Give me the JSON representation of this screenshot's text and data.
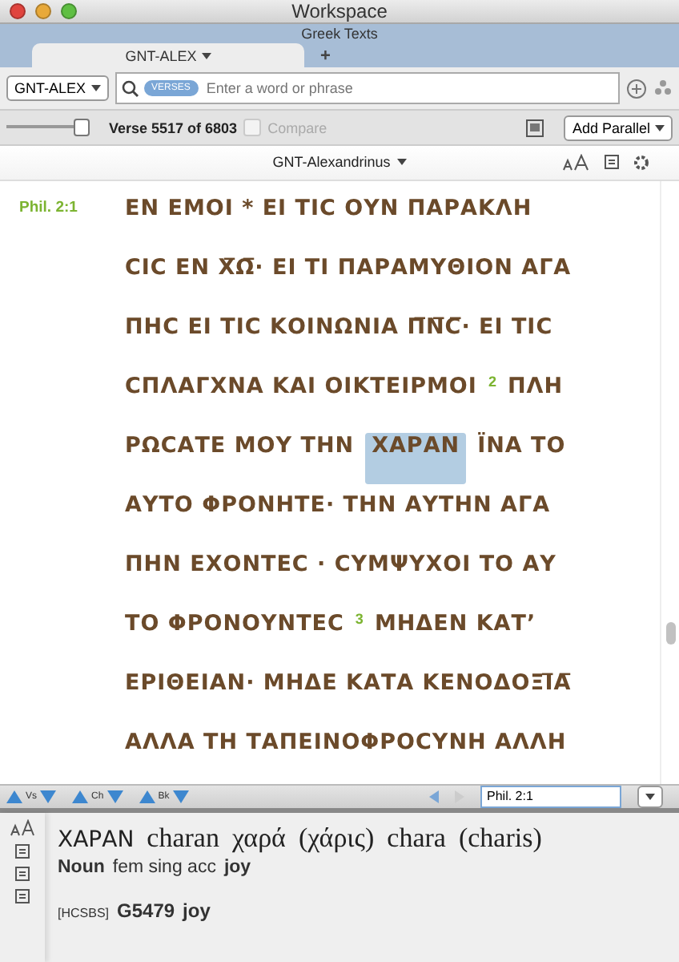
{
  "window": {
    "title": "Workspace"
  },
  "tab_group": {
    "title": "Greek Texts",
    "tabs": [
      {
        "label": "GNT-ALEX",
        "selected": true
      }
    ],
    "add_tab": "+"
  },
  "search_bar": {
    "version": "GNT-ALEX",
    "scope": "VERSES",
    "placeholder": "Enter a word or phrase"
  },
  "toolbar": {
    "slider": {
      "level": 1
    },
    "verse_status": "Verse 5517 of 6803",
    "compare": {
      "label": "Compare",
      "checked": false,
      "disabled": true
    },
    "add_parallel": "Add Parallel"
  },
  "text_header": {
    "title": "GNT-Alexandrinus"
  },
  "passage": {
    "reference": "Phil. 2:1",
    "lines": [
      {
        "segments": [
          {
            "kind": "text",
            "text": "ΕΝ ΕΜΟΙ * ΕΙ ΤΙϹ ΟΥΝ ΠΑΡΑΚΛΗ"
          }
        ]
      },
      {
        "segments": [
          {
            "kind": "text",
            "text": "ϹΙϹ ΕΝ Χ̅Ω̅· ΕΙ ΤΙ ΠΑΡΑΜΥΘΙΟΝ ΑΓΑ"
          }
        ]
      },
      {
        "segments": [
          {
            "kind": "text",
            "text": "ΠΗϹ ΕΙ ΤΙϹ ΚΟΙΝΩΝΙΑ Π̅Ν̅Ϲ̅· ΕΙ ΤΙϹ"
          }
        ]
      },
      {
        "segments": [
          {
            "kind": "text",
            "text": "ϹΠΛΑΓΧΝΑ ΚΑΙ ΟΙΚΤΕΙΡΜΟΙ"
          },
          {
            "kind": "verse",
            "text": "2"
          },
          {
            "kind": "text",
            "text": "ΠΛΗ"
          }
        ]
      },
      {
        "segments": [
          {
            "kind": "text",
            "text": "ΡΩϹΑΤΕ ΜΟΥ ΤΗΝ"
          },
          {
            "kind": "selected",
            "text": "ΧΑΡΑΝ"
          },
          {
            "kind": "text",
            "text": "ΪΝΑ ΤΟ"
          }
        ]
      },
      {
        "segments": [
          {
            "kind": "text",
            "text": "ΑΥΤΟ ΦΡΟΝΗΤΕ· ΤΗΝ ΑΥΤΗΝ ΑΓΑ"
          }
        ]
      },
      {
        "segments": [
          {
            "kind": "text",
            "text": "ΠΗΝ ΕΧΟΝΤΕϹ · ϹΥΜΨΥΧΟΙ ΤΟ ΑΥ"
          }
        ]
      },
      {
        "segments": [
          {
            "kind": "text",
            "text": "ΤΟ ΦΡΟΝΟΥΝΤΕϹ"
          },
          {
            "kind": "verse",
            "text": "3"
          },
          {
            "kind": "text",
            "text": "ΜΗΔΕΝ ΚΑΤ’"
          }
        ]
      },
      {
        "segments": [
          {
            "kind": "text",
            "text": "ΕΡΙΘΕΙΑΝ· ΜΗΔΕ ΚΑΤΑ ΚΕΝΟΔΟΞΙ̅Α̅"
          }
        ]
      },
      {
        "segments": [
          {
            "kind": "text",
            "text": "ΑΛΛΑ ΤΗ ΤΑΠΕΙΝΟΦΡΟϹΥΝΗ ΑΛΛΗ"
          }
        ]
      }
    ]
  },
  "navigation": {
    "steps": [
      "Vs",
      "Ch",
      "Bk"
    ],
    "reference": "Phil. 2:1"
  },
  "lookup": {
    "forms": [
      "ΧΑΡΑΝ",
      "charan",
      "χαρά",
      "(χάρις)",
      "chara",
      "(charis)"
    ],
    "parsing": {
      "part_of_speech": "Noun",
      "morphology": "fem sing acc",
      "gloss": "joy"
    },
    "strongs": {
      "source": "[HCSBS]",
      "number": "G5479",
      "gloss": "joy"
    }
  }
}
